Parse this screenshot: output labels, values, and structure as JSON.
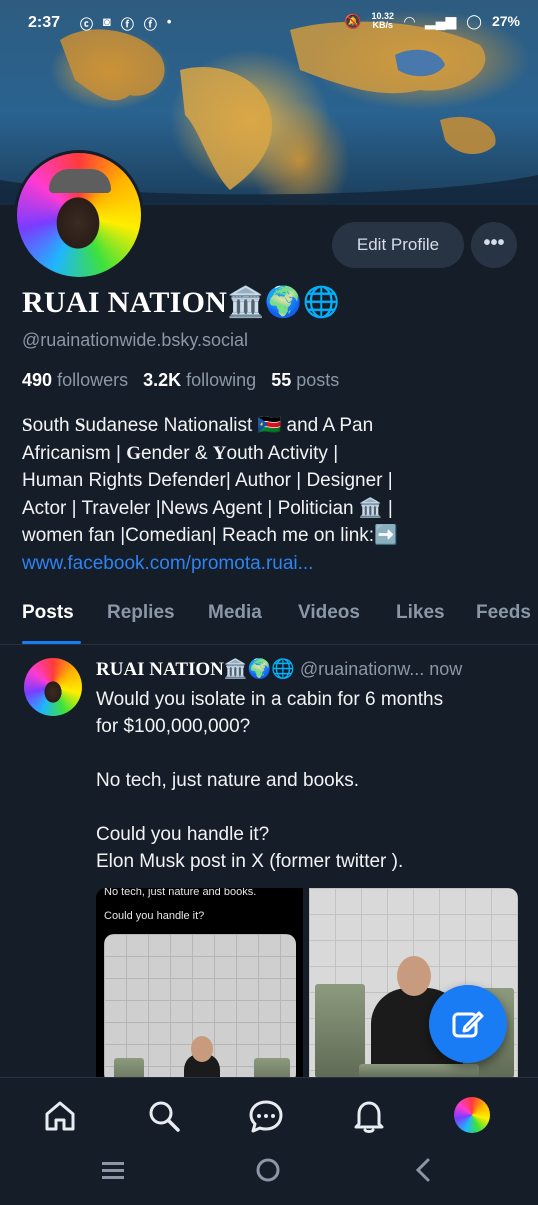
{
  "status_bar": {
    "time": "2:37",
    "net_speed_value": "10.32",
    "net_speed_unit": "KB/s",
    "battery": "27%"
  },
  "profile": {
    "display_name": "RUAI NATION🏛️🌍🌐",
    "handle": "@ruainationwide.bsky.social",
    "edit_button": "Edit Profile",
    "more_button": "•••",
    "stats": {
      "followers_count": "490",
      "followers_label": "followers",
      "following_count": "3.2K",
      "following_label": "following",
      "posts_count": "55",
      "posts_label": "posts"
    },
    "bio": {
      "line1_s1": "S",
      "line1_a": "outh ",
      "line1_s2": "S",
      "line1_b": "udanese Nationalist 🇸🇸 and A Pan",
      "line2_a": "Africanism | ",
      "line2_g": "G",
      "line2_b": "ender & ",
      "line2_y": "Y",
      "line2_c": "outh Activity |",
      "line3": "Human Rights Defender| Author | Designer |",
      "line4": "Actor | Traveler |News Agent | Politician 🏛️ |",
      "line5": "women fan |Comedian| Reach me on link:➡️",
      "link": "www.facebook.com/promota.ruai..."
    }
  },
  "tabs": [
    "Posts",
    "Replies",
    "Media",
    "Videos",
    "Likes",
    "Feeds"
  ],
  "post": {
    "author_name": "RUAI NATION🏛️🌍🌐",
    "author_handle": "@ruainationw...",
    "time": "now",
    "text": "Would you isolate in a cabin for 6 months\nfor $100,000,000?\n\nNo tech, just nature and books.\n\nCould you handle it?\nElon Musk post in X (former  twitter ).",
    "image1_caption_line1": "No tech, just nature and books.",
    "image1_caption_line2": "Could you handle it?"
  },
  "bottom_nav": {
    "icons": [
      "home-icon",
      "search-icon",
      "chat-icon",
      "bell-icon",
      "profile-avatar"
    ]
  },
  "colors": {
    "background": "#151d28",
    "accent": "#1a7cf5",
    "link": "#2f83f0",
    "muted_text": "#8b97a6",
    "button_bg": "#283444"
  }
}
